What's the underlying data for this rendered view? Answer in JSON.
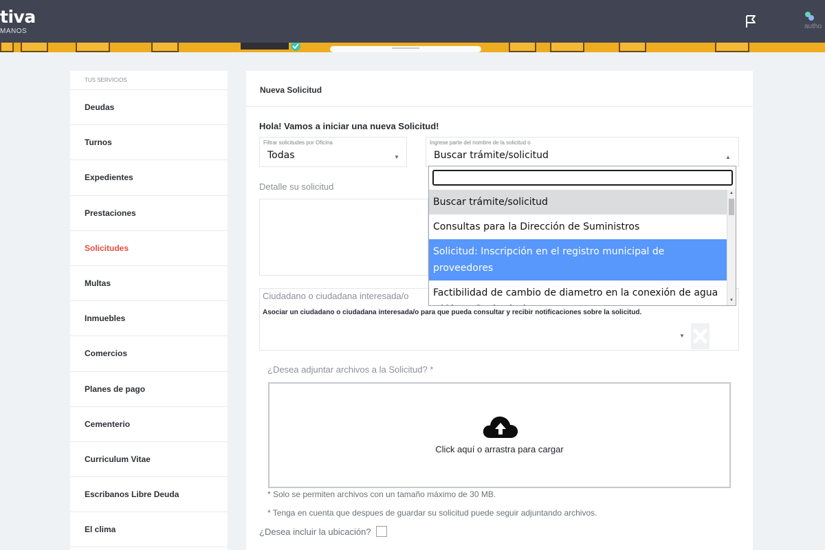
{
  "app": {
    "brand_main": "tiva",
    "brand_sub": "MANOS",
    "user_name": "autho"
  },
  "sidebar": {
    "header": "TUS SERVICIOS",
    "items": [
      {
        "label": "Deudas",
        "active": false
      },
      {
        "label": "Turnos",
        "active": false
      },
      {
        "label": "Expedientes",
        "active": false
      },
      {
        "label": "Prestaciones",
        "active": false
      },
      {
        "label": "Solicitudes",
        "active": true
      },
      {
        "label": "Multas",
        "active": false
      },
      {
        "label": "Inmuebles",
        "active": false
      },
      {
        "label": "Comercios",
        "active": false
      },
      {
        "label": "Planes de pago",
        "active": false
      },
      {
        "label": "Cementerio",
        "active": false
      },
      {
        "label": "Curriculum Vitae",
        "active": false
      },
      {
        "label": "Escribanos Libre Deuda",
        "active": false
      },
      {
        "label": "El clima",
        "active": false
      }
    ]
  },
  "main": {
    "card_title": "Nueva Solicitud",
    "greeting": "Hola! Vamos a iniciar una nueva Solicitud!",
    "office_filter": {
      "label": "Filtrar solicitudes por Oficina",
      "value": "Todas"
    },
    "request_search": {
      "label": "Ingrese parte del nombre de la solicitud o",
      "value": "Buscar trámite/solicitud",
      "search_value": "",
      "options": [
        {
          "label": "Buscar trámite/solicitud",
          "state": "hover"
        },
        {
          "label": "Consultas para la Dirección de Suministros",
          "state": "normal"
        },
        {
          "label": "Solicitud: Inscripción en el registro municipal de proveedores",
          "state": "selected"
        },
        {
          "label": "Factibilidad de cambio de diametro en la conexión de agua - (Obras Sanitarias)",
          "state": "normal"
        }
      ]
    },
    "detail_label": "Detalle su solicitud",
    "citizen": {
      "label": "Ciudadano o ciudadana interesada/o",
      "help": "Asociar un ciudadano o ciudadana interesada/o para que pueda consultar y recibir notificaciones sobre la solicitud."
    },
    "attach": {
      "label": "¿Desea adjuntar archivos a la Solicitud? *",
      "dropzone_text": "Click aquí o arrastra para cargar",
      "note_size": "* Solo se permiten archivos con un tamaño máximo de 30 MB.",
      "note_later": "* Tenga en cuenta que despues de guardar su solicitud puede seguir adjuntando archivos."
    },
    "location": {
      "label": "¿Desea incluir la ubicación?",
      "checked": false
    }
  },
  "colors": {
    "topbar": "#414452",
    "banner": "#eeac20",
    "active_item": "#e74c3c",
    "selected_option": "#5897fb"
  }
}
